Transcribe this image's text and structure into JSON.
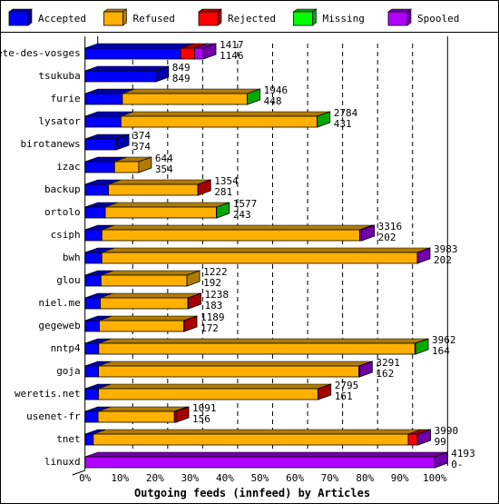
{
  "chart_data": {
    "type": "bar",
    "orientation": "horizontal",
    "stacked": true,
    "three_d": true,
    "title": "Outgoing feeds (innfeed) by Articles",
    "xlabel": "Outgoing feeds (innfeed) by Articles",
    "xlim": [
      0,
      100
    ],
    "x_ticks": [
      "0%",
      "10%",
      "20%",
      "30%",
      "40%",
      "50%",
      "60%",
      "70%",
      "80%",
      "90%",
      "100%"
    ],
    "grid": true,
    "legend_position": "top",
    "categories": [
      "bete-des-vosges",
      "tsukuba",
      "furie",
      "lysator",
      "birotanews",
      "izac",
      "backup",
      "ortolo",
      "csiph",
      "bwh",
      "glou",
      "niel.me",
      "gegeweb",
      "nntp4",
      "goja",
      "weretis.net",
      "usenet-fr",
      "tnet",
      "linuxd"
    ],
    "totals": [
      1417,
      849,
      1946,
      2784,
      374,
      644,
      1354,
      1577,
      3316,
      3983,
      1222,
      1238,
      1189,
      3962,
      3291,
      2795,
      1091,
      3990,
      4193
    ],
    "accepted_labels": [
      "1146",
      "849",
      "448",
      "431",
      "374",
      "354",
      "281",
      "243",
      "202",
      "202",
      "192",
      "183",
      "172",
      "164",
      "162",
      "161",
      "156",
      "99",
      "0-"
    ],
    "series": [
      {
        "name": "Accepted",
        "color": "#0000ff",
        "side": "#0000a8",
        "values": [
          1146,
          849,
          448,
          431,
          374,
          354,
          281,
          243,
          202,
          202,
          192,
          183,
          172,
          164,
          162,
          161,
          156,
          99,
          0
        ]
      },
      {
        "name": "Refused",
        "color": "#ffb000",
        "side": "#b07c00",
        "values": [
          0,
          0,
          1497,
          2350,
          0,
          290,
          1070,
          1332,
          3090,
          3780,
          1030,
          1050,
          1012,
          3790,
          3120,
          2630,
          915,
          3775,
          0
        ]
      },
      {
        "name": "Rejected",
        "color": "#ff0000",
        "side": "#a80000",
        "values": [
          168,
          0,
          0,
          0,
          0,
          0,
          3,
          0,
          4,
          0,
          0,
          5,
          5,
          0,
          0,
          4,
          20,
          108,
          0
        ]
      },
      {
        "name": "Missing",
        "color": "#00ff00",
        "side": "#00a800",
        "values": [
          0,
          0,
          1,
          3,
          0,
          0,
          0,
          2,
          0,
          0,
          0,
          0,
          0,
          8,
          0,
          0,
          0,
          0,
          0
        ]
      },
      {
        "name": "Spooled",
        "color": "#b000ff",
        "side": "#7000a8",
        "values": [
          103,
          0,
          0,
          0,
          0,
          0,
          0,
          0,
          20,
          1,
          0,
          0,
          0,
          0,
          9,
          0,
          0,
          8,
          4193
        ]
      }
    ]
  }
}
